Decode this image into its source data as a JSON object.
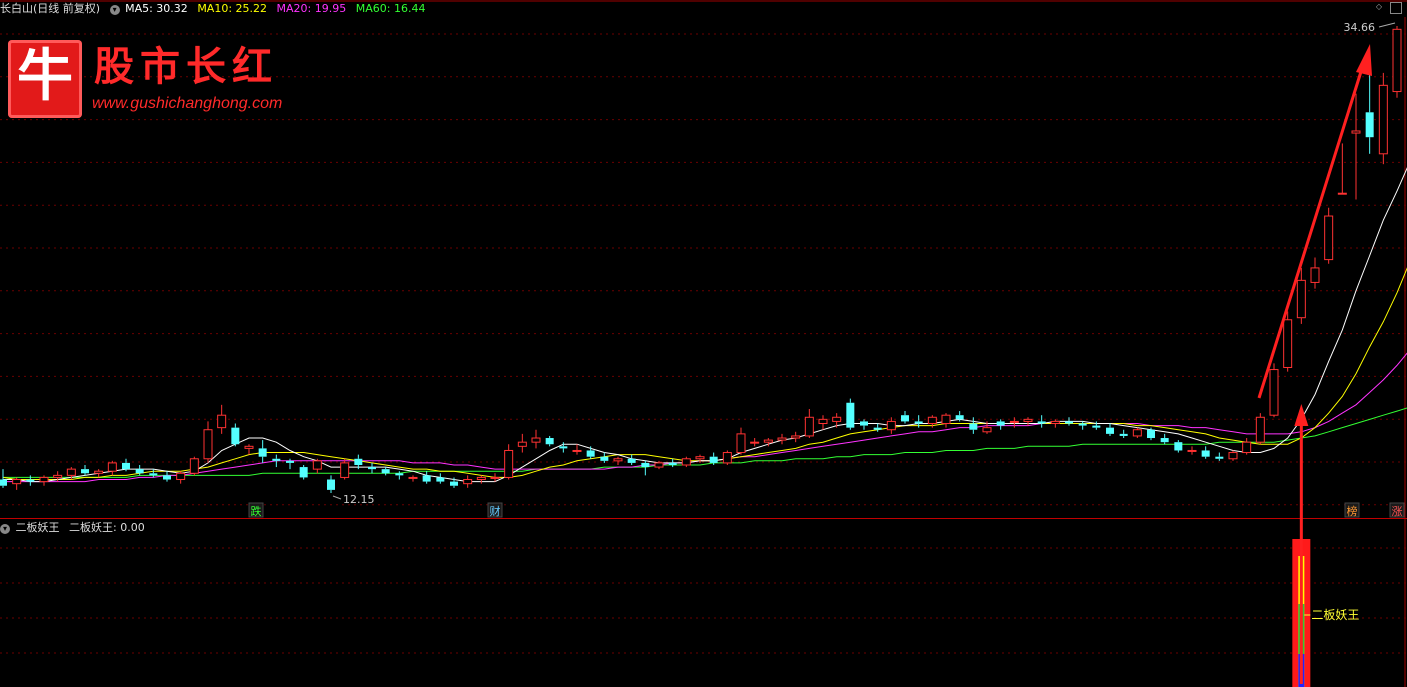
{
  "main_panel": {
    "title": "长白山(日线 前复权)",
    "ma": [
      {
        "label": "MA5: 30.32",
        "color": "#ffffff"
      },
      {
        "label": "MA10: 25.22",
        "color": "#ffff00"
      },
      {
        "label": "MA20: 19.95",
        "color": "#ff33ff"
      },
      {
        "label": "MA60: 16.44",
        "color": "#33ff33"
      }
    ],
    "high_label": "34.66",
    "low_label": "12.15",
    "markers": [
      {
        "text": "跌",
        "color": "#33ff33"
      },
      {
        "text": "财",
        "color": "#66ccff"
      },
      {
        "text": "榜",
        "color": "#ff9933"
      },
      {
        "text": "涨",
        "color": "#ff5555"
      }
    ]
  },
  "logo": {
    "char": "牛",
    "name": "股市长红",
    "url": "www.gushichanghong.com"
  },
  "sub_panel": {
    "title": "二板妖王",
    "value_label": "二板妖王: 0.00",
    "signal_label": "二板妖王"
  },
  "colors": {
    "up": "#ff3232",
    "down": "#54ffff",
    "ma5": "#ffffff",
    "ma10": "#ffff00",
    "ma20": "#ff33ff",
    "ma60": "#33ff33",
    "grid": "#6b0000",
    "arrow": "#ff2020"
  },
  "chart_data": {
    "type": "candlestick",
    "title": "长白山(日线 前复权)",
    "y_range": [
      12.15,
      34.66
    ],
    "candles": [
      {
        "o": 12.8,
        "h": 13.3,
        "l": 12.4,
        "c": 12.5
      },
      {
        "o": 12.6,
        "h": 12.9,
        "l": 12.3,
        "c": 12.8
      },
      {
        "o": 12.8,
        "h": 13.0,
        "l": 12.5,
        "c": 12.7
      },
      {
        "o": 12.7,
        "h": 13.0,
        "l": 12.5,
        "c": 12.9
      },
      {
        "o": 12.9,
        "h": 13.2,
        "l": 12.7,
        "c": 13.0
      },
      {
        "o": 13.0,
        "h": 13.4,
        "l": 12.8,
        "c": 13.3
      },
      {
        "o": 13.3,
        "h": 13.5,
        "l": 13.0,
        "c": 13.1
      },
      {
        "o": 13.1,
        "h": 13.3,
        "l": 12.9,
        "c": 13.2
      },
      {
        "o": 13.2,
        "h": 13.7,
        "l": 13.0,
        "c": 13.6
      },
      {
        "o": 13.6,
        "h": 13.8,
        "l": 13.2,
        "c": 13.3
      },
      {
        "o": 13.3,
        "h": 13.5,
        "l": 13.0,
        "c": 13.1
      },
      {
        "o": 13.1,
        "h": 13.3,
        "l": 12.9,
        "c": 13.0
      },
      {
        "o": 13.0,
        "h": 13.2,
        "l": 12.7,
        "c": 12.8
      },
      {
        "o": 12.8,
        "h": 13.2,
        "l": 12.6,
        "c": 13.1
      },
      {
        "o": 13.1,
        "h": 13.9,
        "l": 13.0,
        "c": 13.8
      },
      {
        "o": 13.8,
        "h": 15.6,
        "l": 13.6,
        "c": 15.2
      },
      {
        "o": 15.3,
        "h": 16.4,
        "l": 15.0,
        "c": 15.9
      },
      {
        "o": 15.3,
        "h": 15.5,
        "l": 14.4,
        "c": 14.5
      },
      {
        "o": 14.3,
        "h": 14.5,
        "l": 14.0,
        "c": 14.4
      },
      {
        "o": 14.3,
        "h": 14.7,
        "l": 13.6,
        "c": 13.9
      },
      {
        "o": 13.8,
        "h": 14.0,
        "l": 13.4,
        "c": 13.7
      },
      {
        "o": 13.7,
        "h": 13.8,
        "l": 13.3,
        "c": 13.6
      },
      {
        "o": 13.4,
        "h": 13.5,
        "l": 12.8,
        "c": 12.9
      },
      {
        "o": 13.3,
        "h": 13.8,
        "l": 13.1,
        "c": 13.7
      },
      {
        "o": 12.8,
        "h": 13.0,
        "l": 12.15,
        "c": 12.3
      },
      {
        "o": 12.9,
        "h": 13.8,
        "l": 12.8,
        "c": 13.6
      },
      {
        "o": 13.8,
        "h": 14.0,
        "l": 13.3,
        "c": 13.5
      },
      {
        "o": 13.4,
        "h": 13.6,
        "l": 13.1,
        "c": 13.3
      },
      {
        "o": 13.3,
        "h": 13.4,
        "l": 13.0,
        "c": 13.1
      },
      {
        "o": 13.1,
        "h": 13.2,
        "l": 12.8,
        "c": 13.0
      },
      {
        "o": 12.9,
        "h": 13.0,
        "l": 12.7,
        "c": 12.9
      },
      {
        "o": 13.0,
        "h": 13.2,
        "l": 12.6,
        "c": 12.7
      },
      {
        "o": 12.9,
        "h": 13.1,
        "l": 12.6,
        "c": 12.7
      },
      {
        "o": 12.7,
        "h": 12.9,
        "l": 12.4,
        "c": 12.5
      },
      {
        "o": 12.6,
        "h": 13.0,
        "l": 12.4,
        "c": 12.8
      },
      {
        "o": 12.8,
        "h": 13.0,
        "l": 12.6,
        "c": 12.9
      },
      {
        "o": 12.9,
        "h": 13.1,
        "l": 12.7,
        "c": 12.9
      },
      {
        "o": 12.9,
        "h": 14.5,
        "l": 12.8,
        "c": 14.2
      },
      {
        "o": 14.4,
        "h": 15.0,
        "l": 14.1,
        "c": 14.6
      },
      {
        "o": 14.6,
        "h": 15.2,
        "l": 14.3,
        "c": 14.8
      },
      {
        "o": 14.8,
        "h": 14.9,
        "l": 14.4,
        "c": 14.5
      },
      {
        "o": 14.4,
        "h": 14.6,
        "l": 14.1,
        "c": 14.3
      },
      {
        "o": 14.2,
        "h": 14.5,
        "l": 14.0,
        "c": 14.2
      },
      {
        "o": 14.2,
        "h": 14.4,
        "l": 13.8,
        "c": 13.9
      },
      {
        "o": 13.9,
        "h": 14.1,
        "l": 13.6,
        "c": 13.7
      },
      {
        "o": 13.7,
        "h": 13.9,
        "l": 13.5,
        "c": 13.8
      },
      {
        "o": 13.8,
        "h": 14.0,
        "l": 13.5,
        "c": 13.6
      },
      {
        "o": 13.6,
        "h": 13.7,
        "l": 13.0,
        "c": 13.4
      },
      {
        "o": 13.4,
        "h": 13.7,
        "l": 13.3,
        "c": 13.6
      },
      {
        "o": 13.6,
        "h": 13.8,
        "l": 13.4,
        "c": 13.5
      },
      {
        "o": 13.5,
        "h": 13.9,
        "l": 13.4,
        "c": 13.8
      },
      {
        "o": 13.8,
        "h": 14.0,
        "l": 13.6,
        "c": 13.9
      },
      {
        "o": 13.9,
        "h": 14.1,
        "l": 13.5,
        "c": 13.6
      },
      {
        "o": 13.6,
        "h": 14.2,
        "l": 13.5,
        "c": 14.1
      },
      {
        "o": 14.1,
        "h": 15.3,
        "l": 14.0,
        "c": 15.0
      },
      {
        "o": 14.6,
        "h": 14.8,
        "l": 14.4,
        "c": 14.6
      },
      {
        "o": 14.6,
        "h": 14.8,
        "l": 14.4,
        "c": 14.7
      },
      {
        "o": 14.7,
        "h": 15.0,
        "l": 14.5,
        "c": 14.8
      },
      {
        "o": 14.8,
        "h": 15.1,
        "l": 14.6,
        "c": 14.9
      },
      {
        "o": 14.9,
        "h": 16.2,
        "l": 14.8,
        "c": 15.8
      },
      {
        "o": 15.5,
        "h": 15.9,
        "l": 15.2,
        "c": 15.7
      },
      {
        "o": 15.6,
        "h": 16.0,
        "l": 15.3,
        "c": 15.8
      },
      {
        "o": 16.5,
        "h": 16.7,
        "l": 15.2,
        "c": 15.3
      },
      {
        "o": 15.6,
        "h": 15.7,
        "l": 15.2,
        "c": 15.4
      },
      {
        "o": 15.3,
        "h": 15.5,
        "l": 15.1,
        "c": 15.2
      },
      {
        "o": 15.2,
        "h": 15.8,
        "l": 15.0,
        "c": 15.6
      },
      {
        "o": 15.9,
        "h": 16.1,
        "l": 15.5,
        "c": 15.6
      },
      {
        "o": 15.6,
        "h": 15.9,
        "l": 15.3,
        "c": 15.5
      },
      {
        "o": 15.5,
        "h": 15.9,
        "l": 15.3,
        "c": 15.8
      },
      {
        "o": 15.5,
        "h": 16.0,
        "l": 15.3,
        "c": 15.9
      },
      {
        "o": 15.9,
        "h": 16.1,
        "l": 15.6,
        "c": 15.7
      },
      {
        "o": 15.5,
        "h": 15.8,
        "l": 15.0,
        "c": 15.2
      },
      {
        "o": 15.1,
        "h": 15.6,
        "l": 15.0,
        "c": 15.3
      },
      {
        "o": 15.6,
        "h": 15.7,
        "l": 15.2,
        "c": 15.4
      },
      {
        "o": 15.6,
        "h": 15.8,
        "l": 15.3,
        "c": 15.6
      },
      {
        "o": 15.6,
        "h": 15.8,
        "l": 15.4,
        "c": 15.7
      },
      {
        "o": 15.6,
        "h": 15.9,
        "l": 15.3,
        "c": 15.5
      },
      {
        "o": 15.5,
        "h": 15.7,
        "l": 15.3,
        "c": 15.6
      },
      {
        "o": 15.6,
        "h": 15.8,
        "l": 15.4,
        "c": 15.5
      },
      {
        "o": 15.5,
        "h": 15.6,
        "l": 15.2,
        "c": 15.4
      },
      {
        "o": 15.4,
        "h": 15.6,
        "l": 15.2,
        "c": 15.3
      },
      {
        "o": 15.3,
        "h": 15.5,
        "l": 14.9,
        "c": 15.0
      },
      {
        "o": 15.0,
        "h": 15.2,
        "l": 14.8,
        "c": 14.9
      },
      {
        "o": 14.9,
        "h": 15.3,
        "l": 14.8,
        "c": 15.2
      },
      {
        "o": 15.2,
        "h": 15.3,
        "l": 14.7,
        "c": 14.8
      },
      {
        "o": 14.8,
        "h": 15.0,
        "l": 14.5,
        "c": 14.6
      },
      {
        "o": 14.6,
        "h": 14.7,
        "l": 14.1,
        "c": 14.2
      },
      {
        "o": 14.2,
        "h": 14.4,
        "l": 14.0,
        "c": 14.2
      },
      {
        "o": 14.2,
        "h": 14.4,
        "l": 13.8,
        "c": 13.9
      },
      {
        "o": 13.9,
        "h": 14.1,
        "l": 13.7,
        "c": 13.8
      },
      {
        "o": 13.8,
        "h": 14.2,
        "l": 13.7,
        "c": 14.1
      },
      {
        "o": 14.1,
        "h": 14.8,
        "l": 14.0,
        "c": 14.6
      },
      {
        "o": 14.6,
        "h": 16.0,
        "l": 14.5,
        "c": 15.8
      },
      {
        "o": 15.9,
        "h": 18.4,
        "l": 15.8,
        "c": 18.1
      },
      {
        "o": 18.2,
        "h": 20.9,
        "l": 18.0,
        "c": 20.5
      },
      {
        "o": 20.6,
        "h": 23.0,
        "l": 20.3,
        "c": 22.4
      },
      {
        "o": 22.3,
        "h": 23.5,
        "l": 22.0,
        "c": 23.0
      },
      {
        "o": 23.4,
        "h": 25.9,
        "l": 23.2,
        "c": 25.5
      },
      {
        "o": 26.6,
        "h": 29.0,
        "l": 26.6,
        "c": 26.6
      },
      {
        "o": 29.5,
        "h": 31.4,
        "l": 26.3,
        "c": 29.6
      },
      {
        "o": 30.5,
        "h": 32.6,
        "l": 28.5,
        "c": 29.3
      },
      {
        "o": 28.5,
        "h": 32.4,
        "l": 28.0,
        "c": 31.8
      },
      {
        "o": 31.5,
        "h": 34.66,
        "l": 31.2,
        "c": 34.5
      }
    ],
    "ma5": [
      12.8,
      12.8,
      12.7,
      12.7,
      12.8,
      12.9,
      13.0,
      13.1,
      13.2,
      13.3,
      13.3,
      13.3,
      13.2,
      13.1,
      13.2,
      13.6,
      14.2,
      14.5,
      14.8,
      14.8,
      14.6,
      14.2,
      13.9,
      13.7,
      13.4,
      13.4,
      13.4,
      13.4,
      13.4,
      13.3,
      13.2,
      13.0,
      12.9,
      12.8,
      12.7,
      12.7,
      12.7,
      13.0,
      13.4,
      13.8,
      14.2,
      14.5,
      14.5,
      14.3,
      14.1,
      14.0,
      13.8,
      13.7,
      13.6,
      13.6,
      13.6,
      13.7,
      13.7,
      13.8,
      14.1,
      14.3,
      14.5,
      14.7,
      14.8,
      15.0,
      15.2,
      15.4,
      15.5,
      15.5,
      15.5,
      15.4,
      15.4,
      15.5,
      15.5,
      15.6,
      15.7,
      15.6,
      15.5,
      15.5,
      15.5,
      15.5,
      15.5,
      15.6,
      15.6,
      15.6,
      15.5,
      15.5,
      15.4,
      15.3,
      15.2,
      15.1,
      15.0,
      14.8,
      14.6,
      14.4,
      14.2,
      14.1,
      14.1,
      14.3,
      14.8,
      15.7,
      16.9,
      18.5,
      20.0,
      21.9,
      23.6,
      25.3,
      26.7,
      28.2,
      30.32
    ],
    "ma10": [
      12.9,
      12.8,
      12.8,
      12.8,
      12.8,
      12.8,
      12.9,
      12.9,
      13.0,
      13.0,
      13.1,
      13.2,
      13.2,
      13.2,
      13.3,
      13.4,
      13.6,
      13.8,
      14.0,
      14.1,
      14.1,
      14.1,
      14.1,
      14.0,
      13.9,
      13.8,
      13.7,
      13.6,
      13.5,
      13.4,
      13.3,
      13.3,
      13.2,
      13.2,
      13.1,
      13.0,
      12.9,
      12.9,
      13.0,
      13.2,
      13.4,
      13.5,
      13.7,
      13.8,
      13.9,
      14.0,
      14.0,
      14.0,
      13.9,
      13.8,
      13.7,
      13.7,
      13.7,
      13.8,
      13.9,
      14.0,
      14.1,
      14.2,
      14.3,
      14.5,
      14.6,
      14.8,
      15.0,
      15.1,
      15.2,
      15.3,
      15.4,
      15.4,
      15.4,
      15.5,
      15.5,
      15.5,
      15.5,
      15.5,
      15.5,
      15.5,
      15.5,
      15.5,
      15.5,
      15.5,
      15.5,
      15.5,
      15.5,
      15.4,
      15.4,
      15.3,
      15.2,
      15.1,
      15.0,
      14.8,
      14.7,
      14.6,
      14.5,
      14.5,
      14.5,
      14.8,
      15.3,
      16.0,
      16.8,
      17.9,
      19.2,
      20.4,
      21.8,
      23.4,
      25.22
    ],
    "ma20": [
      12.7,
      12.7,
      12.7,
      12.7,
      12.7,
      12.7,
      12.7,
      12.8,
      12.8,
      12.8,
      12.9,
      12.9,
      13.0,
      13.0,
      13.1,
      13.2,
      13.3,
      13.4,
      13.5,
      13.6,
      13.7,
      13.7,
      13.7,
      13.7,
      13.7,
      13.7,
      13.7,
      13.7,
      13.7,
      13.7,
      13.6,
      13.6,
      13.6,
      13.5,
      13.5,
      13.4,
      13.3,
      13.3,
      13.3,
      13.3,
      13.3,
      13.3,
      13.3,
      13.3,
      13.3,
      13.4,
      13.4,
      13.5,
      13.5,
      13.6,
      13.6,
      13.7,
      13.7,
      13.8,
      13.9,
      13.9,
      14.0,
      14.1,
      14.2,
      14.3,
      14.4,
      14.5,
      14.6,
      14.7,
      14.8,
      14.9,
      15.0,
      15.1,
      15.1,
      15.2,
      15.3,
      15.3,
      15.4,
      15.4,
      15.4,
      15.4,
      15.5,
      15.5,
      15.5,
      15.5,
      15.5,
      15.5,
      15.5,
      15.5,
      15.4,
      15.4,
      15.4,
      15.3,
      15.3,
      15.2,
      15.1,
      15.0,
      15.0,
      15.0,
      15.0,
      15.1,
      15.3,
      15.6,
      16.0,
      16.4,
      17.0,
      17.6,
      18.3,
      19.1,
      19.95
    ],
    "ma60": [
      12.9,
      12.9,
      12.9,
      12.9,
      12.9,
      12.9,
      12.9,
      12.9,
      12.9,
      12.9,
      13.0,
      13.0,
      13.0,
      13.0,
      13.0,
      13.0,
      13.0,
      13.0,
      13.0,
      13.1,
      13.1,
      13.1,
      13.1,
      13.1,
      13.1,
      13.1,
      13.1,
      13.1,
      13.1,
      13.1,
      13.2,
      13.2,
      13.2,
      13.2,
      13.2,
      13.2,
      13.2,
      13.2,
      13.2,
      13.3,
      13.3,
      13.3,
      13.3,
      13.3,
      13.4,
      13.4,
      13.4,
      13.4,
      13.5,
      13.5,
      13.5,
      13.5,
      13.6,
      13.6,
      13.6,
      13.7,
      13.7,
      13.7,
      13.8,
      13.8,
      13.8,
      13.9,
      13.9,
      14.0,
      14.0,
      14.0,
      14.1,
      14.1,
      14.1,
      14.2,
      14.2,
      14.2,
      14.3,
      14.3,
      14.3,
      14.4,
      14.4,
      14.4,
      14.4,
      14.5,
      14.5,
      14.5,
      14.5,
      14.5,
      14.5,
      14.5,
      14.5,
      14.5,
      14.5,
      14.6,
      14.6,
      14.6,
      14.6,
      14.6,
      14.7,
      14.8,
      14.9,
      15.1,
      15.3,
      15.5,
      15.7,
      15.9,
      16.1,
      16.3,
      16.44
    ],
    "signal": {
      "label": "二板妖王",
      "value": 0.0,
      "index": 95
    }
  }
}
